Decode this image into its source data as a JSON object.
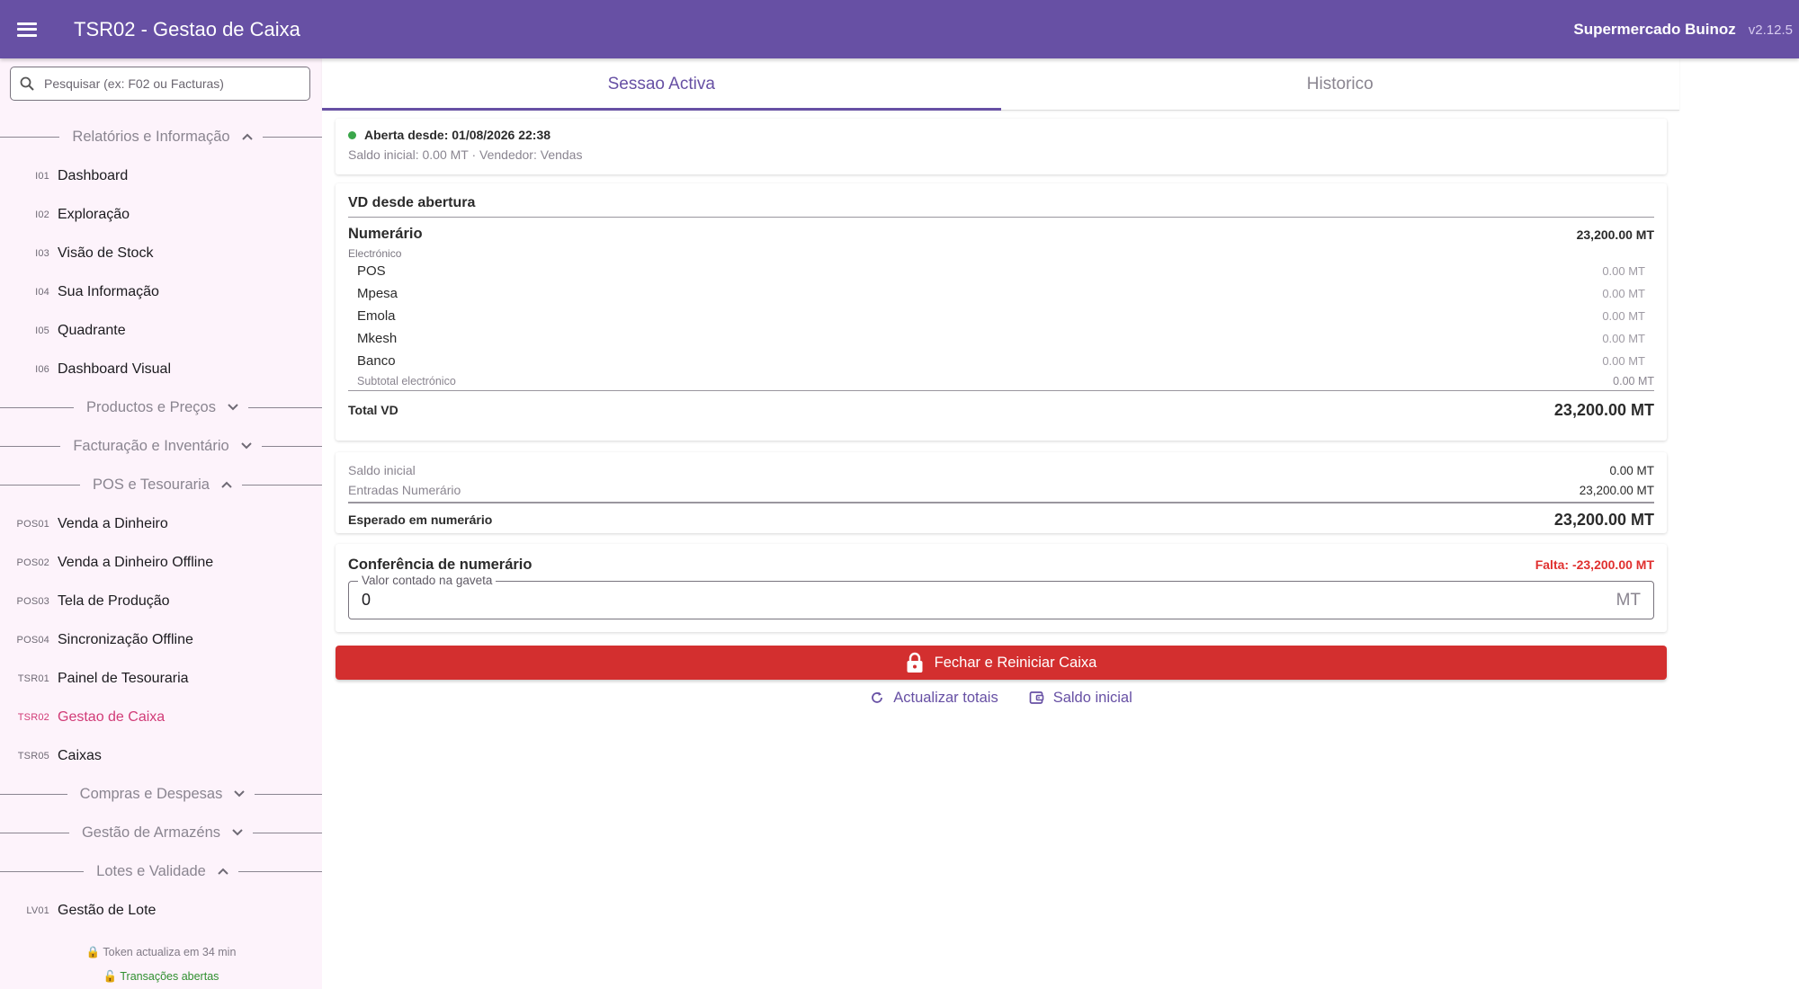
{
  "header": {
    "title": "TSR02 - Gestao de Caixa",
    "company": "Supermercado Buinoz",
    "version": "v2.12.5"
  },
  "sidebar": {
    "search_placeholder": "Pesquisar (ex: F02 ou Facturas)",
    "sections": [
      {
        "label": "Relatórios e Informação",
        "expanded": true,
        "items": [
          {
            "code": "I01",
            "label": "Dashboard"
          },
          {
            "code": "I02",
            "label": "Exploração"
          },
          {
            "code": "I03",
            "label": "Visão de Stock"
          },
          {
            "code": "I04",
            "label": "Sua Informação"
          },
          {
            "code": "I05",
            "label": "Quadrante"
          },
          {
            "code": "I06",
            "label": "Dashboard Visual"
          }
        ]
      },
      {
        "label": "Productos e Preços",
        "expanded": false,
        "items": []
      },
      {
        "label": "Facturação e Inventário",
        "expanded": false,
        "items": []
      },
      {
        "label": "POS e Tesouraria",
        "expanded": true,
        "items": [
          {
            "code": "POS01",
            "label": "Venda a Dinheiro"
          },
          {
            "code": "POS02",
            "label": "Venda a Dinheiro Offline"
          },
          {
            "code": "POS03",
            "label": "Tela de Produção"
          },
          {
            "code": "POS04",
            "label": "Sincronização Offline"
          },
          {
            "code": "TSR01",
            "label": "Painel de Tesouraria"
          },
          {
            "code": "TSR02",
            "label": "Gestao de Caixa",
            "active": true
          },
          {
            "code": "TSR05",
            "label": "Caixas"
          }
        ]
      },
      {
        "label": "Compras e Despesas",
        "expanded": false,
        "items": []
      },
      {
        "label": "Gestão de Armazéns",
        "expanded": false,
        "items": []
      },
      {
        "label": "Lotes e Validade",
        "expanded": true,
        "items": [
          {
            "code": "LV01",
            "label": "Gestão de Lote"
          }
        ]
      }
    ],
    "token_text": "🔒 Token actualiza em 34 min",
    "transactions_text": "🔓 Transações abertas"
  },
  "tabs": {
    "active": "Sessao Activa",
    "history": "Historico"
  },
  "session": {
    "opened": "Aberta desde: 01/08/2026 22:38",
    "details": "Saldo inicial: 0.00 MT · Vendedor: Vendas",
    "status_color": "#3aa64a"
  },
  "vd": {
    "title": "VD desde abertura",
    "cash_label": "Numerário",
    "cash_value": "23,200.00 MT",
    "electronic_title": "Electrónico",
    "electronic": [
      {
        "label": "POS",
        "value": "0.00 MT"
      },
      {
        "label": "Mpesa",
        "value": "0.00 MT"
      },
      {
        "label": "Emola",
        "value": "0.00 MT"
      },
      {
        "label": "Mkesh",
        "value": "0.00 MT"
      },
      {
        "label": "Banco",
        "value": "0.00 MT"
      }
    ],
    "subtotal_label": "Subtotal electrónico",
    "subtotal_value": "0.00 MT",
    "total_label": "Total VD",
    "total_value": "23,200.00 MT"
  },
  "balance": {
    "initial_label": "Saldo inicial",
    "initial_value": "0.00 MT",
    "entries_label": "Entradas Numerário",
    "entries_value": "23,200.00 MT",
    "expected_label": "Esperado em numerário",
    "expected_value": "23,200.00 MT"
  },
  "conference": {
    "title": "Conferência de numerário",
    "shortfall": "Falta: -23,200.00 MT",
    "field_label": "Valor contado na gaveta",
    "field_value": "0",
    "field_suffix": "MT"
  },
  "actions": {
    "close_button": "Fechar e Reiniciar Caixa",
    "refresh_link": "Actualizar totais",
    "initial_balance_link": "Saldo inicial"
  },
  "colors": {
    "primary": "#6750a4",
    "danger": "#d32f2f",
    "active_nav": "#d13b77",
    "success": "#3aa64a"
  }
}
